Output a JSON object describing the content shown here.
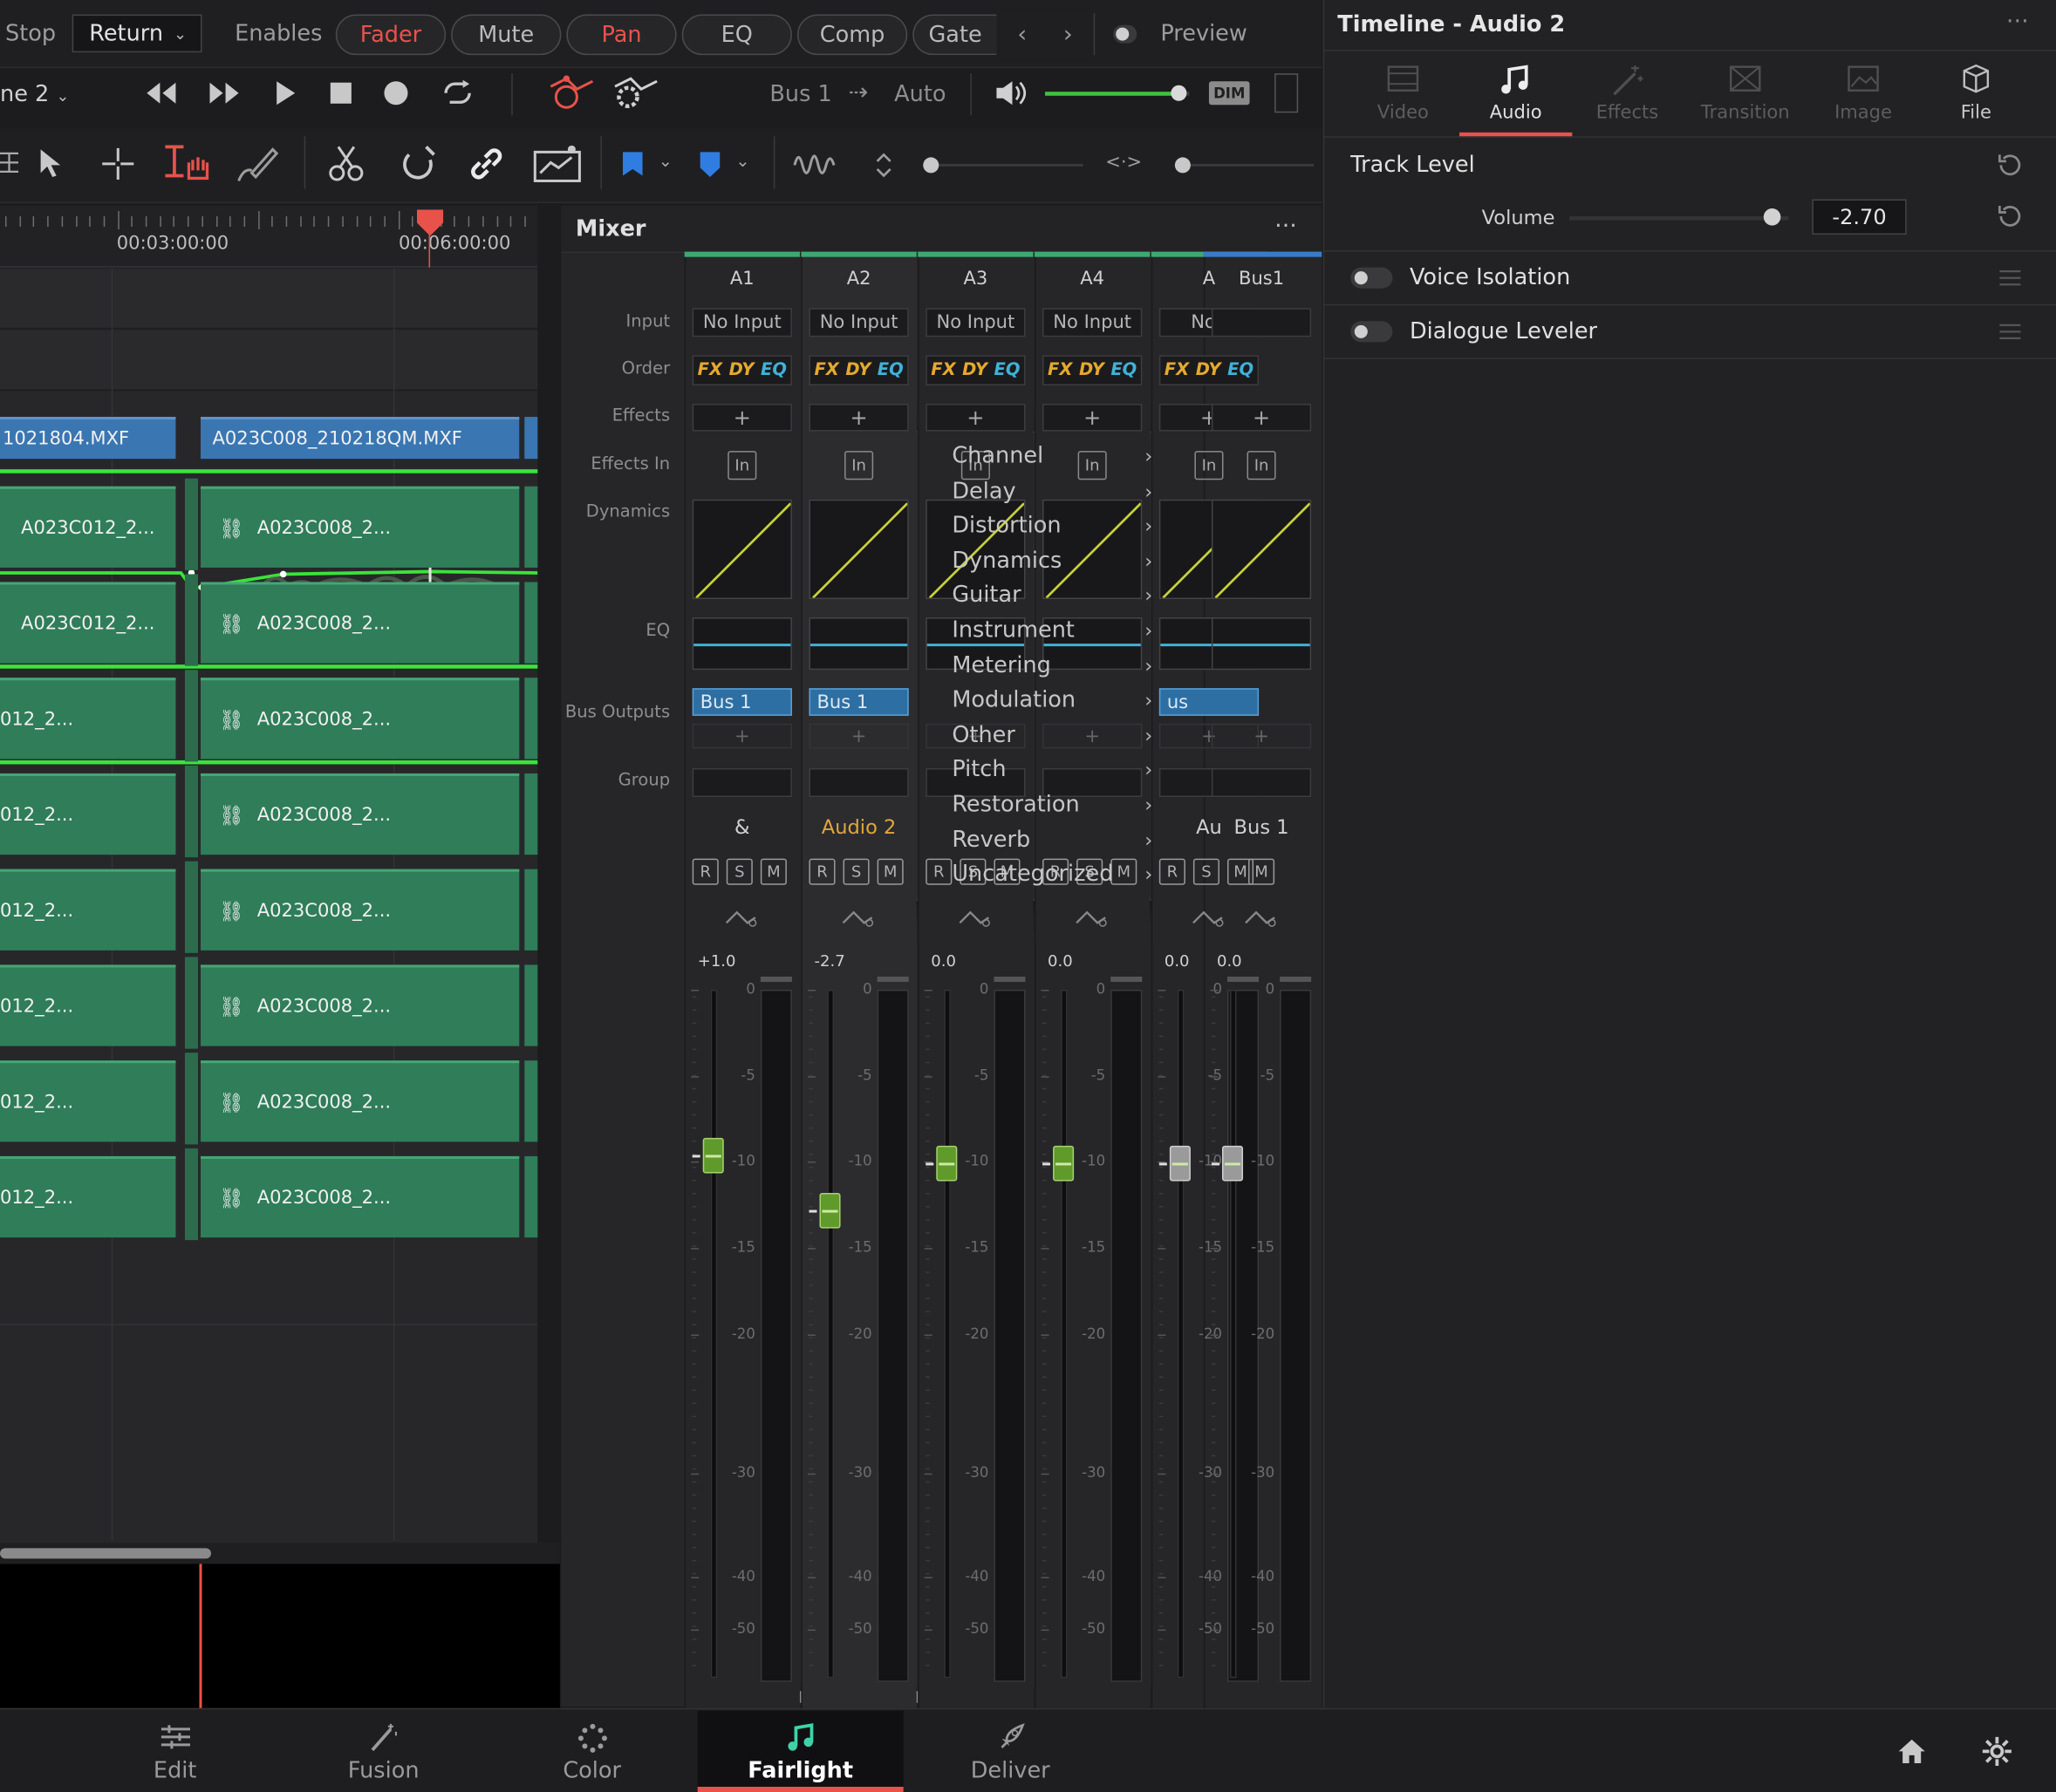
{
  "header": {
    "stop_label": "Stop",
    "return_label": "Return",
    "enables_label": "Enables",
    "enables_pills": [
      {
        "label": "Fader",
        "active": true
      },
      {
        "label": "Mute",
        "active": false
      },
      {
        "label": "Pan",
        "active": true
      },
      {
        "label": "EQ",
        "active": false
      },
      {
        "label": "Comp",
        "active": false
      },
      {
        "label": "Gate",
        "active": false
      }
    ],
    "preview_label": "Preview",
    "timeline_name": "ne 2"
  },
  "transport": {
    "bus_label": "Bus 1",
    "arrow_glyph": "⇢",
    "auto_label": "Auto",
    "dim_label": "DIM",
    "volume_fraction": 0.93
  },
  "timeline": {
    "timecodes": [
      "00:03:00:00",
      "00:06:00:00"
    ],
    "clips_blue": [
      "1021804.MXF",
      "A023C008_210218QM.MXF"
    ],
    "clips_green": [
      {
        "left": "A023C012_2...",
        "right": "A023C008_2..."
      },
      {
        "left": "A023C012_2...",
        "right": "A023C008_2..."
      },
      {
        "left": "012_2...",
        "right": "A023C008_2..."
      },
      {
        "left": "012_2...",
        "right": "A023C008_2..."
      },
      {
        "left": "012_2...",
        "right": "A023C008_2..."
      },
      {
        "left": "012_2...",
        "right": "A023C008_2..."
      },
      {
        "left": "012_2...",
        "right": "A023C008_2..."
      },
      {
        "left": "012_2...",
        "right": "A023C008_2..."
      }
    ]
  },
  "mixer": {
    "title": "Mixer",
    "row_labels": {
      "input": "Input",
      "order": "Order",
      "effects": "Effects",
      "effects_in": "Effects In",
      "dynamics": "Dynamics",
      "eq": "EQ",
      "bus_outputs": "Bus Outputs",
      "group": "Group"
    },
    "order_tokens": {
      "fx": "FX",
      "dy": "DY",
      "eq": "EQ"
    },
    "plus": "+",
    "in_label": "In",
    "rsm": {
      "r": "R",
      "s": "S",
      "m": "M"
    },
    "scale_marks": [
      "0",
      "-5",
      "-10",
      "-15",
      "-20",
      "-30",
      "-40",
      "-50"
    ],
    "channels": [
      {
        "id": "A1",
        "input": "No Input",
        "bus": "Bus 1",
        "name": "&",
        "level": "+1.0",
        "fader_db": 1.0
      },
      {
        "id": "A2",
        "input": "No Input",
        "bus": "Bus 1",
        "name": "Audio 2",
        "level": "-2.7",
        "fader_db": -2.7
      },
      {
        "id": "A3",
        "input": "No Input",
        "bus": "",
        "name": "",
        "level": "0.0",
        "fader_db": 0.0
      },
      {
        "id": "A4",
        "input": "No Input",
        "bus": "",
        "name": "",
        "level": "0.0",
        "fader_db": 0.0
      },
      {
        "id": "A",
        "input": "No I",
        "bus": "us",
        "name": "Au",
        "level": "0.0",
        "fader_db": 0.0
      }
    ],
    "bus_channel": {
      "id": "Bus1",
      "name": "Bus 1",
      "level": "0.0",
      "fader_db": 0.0
    },
    "colors": {
      "selected_name": "#e0a63b",
      "order_fx": "#e5a92e",
      "order_eq": "#3fb2d8",
      "fader_green": "#5f9a2b"
    }
  },
  "effects_menu": {
    "items": [
      "Channel",
      "Delay",
      "Distortion",
      "Dynamics",
      "Guitar",
      "Instrument",
      "Metering",
      "Modulation",
      "Other",
      "Pitch",
      "Restoration",
      "Reverb",
      "Uncategorized"
    ]
  },
  "inspector": {
    "title": "Timeline - Audio 2",
    "tabs": [
      {
        "label": "Video",
        "icon": "film-icon",
        "active": false
      },
      {
        "label": "Audio",
        "icon": "music-note-icon",
        "active": true
      },
      {
        "label": "Effects",
        "icon": "magic-wand-icon",
        "active": false
      },
      {
        "label": "Transition",
        "icon": "transition-icon",
        "active": false
      },
      {
        "label": "Image",
        "icon": "image-icon",
        "active": false
      },
      {
        "label": "File",
        "icon": "file-icon",
        "active": false
      }
    ],
    "section_title": "Track Level",
    "volume_label": "Volume",
    "volume_value": "-2.70",
    "volume_fraction": 0.92,
    "voice_isolation": "Voice Isolation",
    "dialogue_leveler": "Dialogue Leveler"
  },
  "bottom_nav": [
    {
      "label": "Edit",
      "icon": "edit-icon",
      "active": false
    },
    {
      "label": "Fusion",
      "icon": "fusion-icon",
      "active": false
    },
    {
      "label": "Color",
      "icon": "color-icon",
      "active": false
    },
    {
      "label": "Fairlight",
      "icon": "fairlight-icon",
      "active": true
    },
    {
      "label": "Deliver",
      "icon": "deliver-icon",
      "active": false
    }
  ],
  "accent": "#e8524a"
}
